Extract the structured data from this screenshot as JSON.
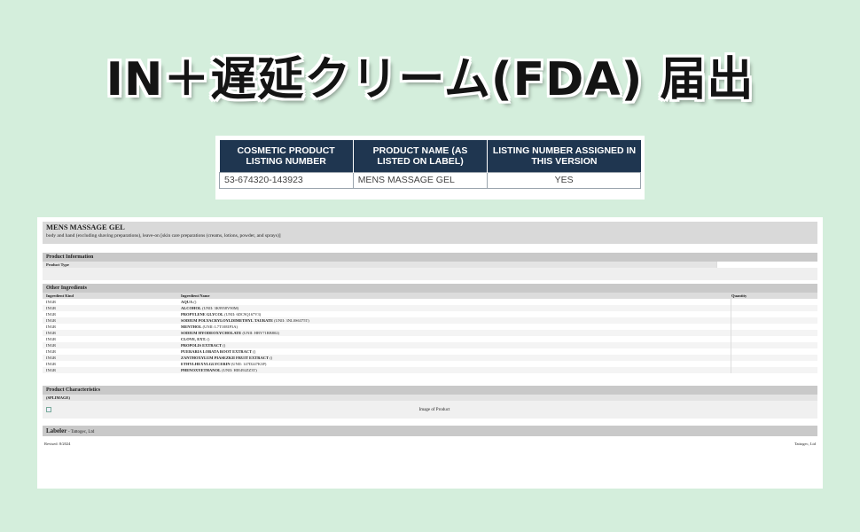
{
  "headline": "IN＋遅延クリーム(FDA) 届出",
  "listing": {
    "headers": [
      "COSMETIC PRODUCT LISTING NUMBER",
      "PRODUCT NAME (AS LISTED ON LABEL)",
      "LISTING NUMBER ASSIGNED IN THIS VERSION"
    ],
    "row": [
      "53-674320-143923",
      "MENS MASSAGE GEL",
      "YES"
    ]
  },
  "doc": {
    "title": "MENS MASSAGE GEL",
    "subtitle": "body and hand (excluding shaving preparations), leave-on [skin care preparations (creams, lotions, powder, and sprays)]",
    "product_info": {
      "heading": "Product Information",
      "product_type_label": "Product Type"
    },
    "other_ingredients": {
      "heading": "Other Ingredients",
      "col_kind": "Ingredient Kind",
      "col_name": "Ingredient Name",
      "col_qty": "Quantity",
      "rows": [
        {
          "kind": "INGR",
          "name": "AQUA",
          "unii": "()"
        },
        {
          "kind": "INGR",
          "name": "ALCOHOL",
          "unii": "(UNII: 3K9958V90M)"
        },
        {
          "kind": "INGR",
          "name": "PROPYLENE GLYCOL",
          "unii": "(UNII: 6DC9Q167V3)"
        },
        {
          "kind": "INGR",
          "name": "SODIUM POLYACRYLOYLDIMETHYL TAURATE",
          "unii": "(UNII: 3NL0S6375T)"
        },
        {
          "kind": "INGR",
          "name": "MENTHOL",
          "unii": "(UNII: L7T10EIP3A)"
        },
        {
          "kind": "INGR",
          "name": "SODIUM HYODEOXYCHOLATE",
          "unii": "(UNII: HBY71RB802)"
        },
        {
          "kind": "INGR",
          "name": "CLOVE, EXT.",
          "unii": "()"
        },
        {
          "kind": "INGR",
          "name": "PROPOLIS EXTRACT",
          "unii": "()"
        },
        {
          "kind": "INGR",
          "name": "PUERARIA LOBATA ROOT EXTRACT",
          "unii": "()"
        },
        {
          "kind": "INGR",
          "name": "ZANTHOXYLUM PIASEZKII FRUIT EXTRACT",
          "unii": "()"
        },
        {
          "kind": "INGR",
          "name": "ETHYLHEXYLGLYCERIN",
          "unii": "(UNII: 147D247K3P)"
        },
        {
          "kind": "INGR",
          "name": "PHENOXYETHANOL",
          "unii": "(UNII: HIE492ZZ3T)"
        }
      ]
    },
    "characteristics": {
      "heading": "Product Characteristics",
      "splimage": "(SPLIMAGE)",
      "image_caption": "Image of Product"
    },
    "labeler": {
      "label": "Labeler",
      "value": "- Tattogec, Ltd"
    },
    "footer": {
      "revised": "Revised: 8/2024",
      "company": "Tattogec, Ltd"
    }
  }
}
